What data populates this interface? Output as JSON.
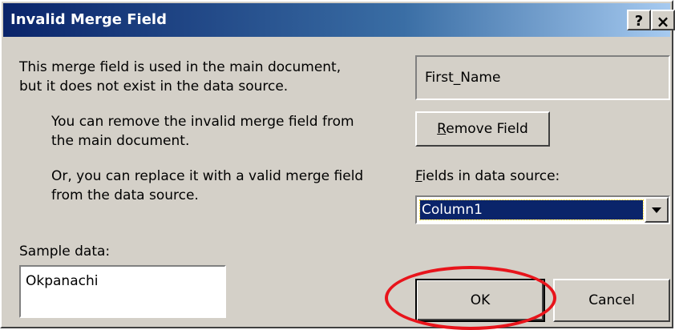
{
  "dialog": {
    "title": "Invalid Merge Field",
    "help_button": "?",
    "close_button": "×"
  },
  "messages": {
    "line1": "This merge field is used in the main document,",
    "line2": "but it does not exist in the data source.",
    "remove_line1": "You can remove the invalid merge field from",
    "remove_line2": "the main document.",
    "replace_line1": "Or, you can replace it with a valid merge field",
    "replace_line2": "from the data source."
  },
  "field": {
    "name": "First_Name"
  },
  "remove_button": {
    "accel": "R",
    "rest": "emove Field"
  },
  "fields_in_source": {
    "label_accel": "F",
    "label_rest": "ields in data source:",
    "selected": "Column1"
  },
  "sample": {
    "label": "Sample data:",
    "value": "Okpanachi"
  },
  "buttons": {
    "ok": "OK",
    "cancel": "Cancel"
  },
  "annotation": {
    "color": "#e8141b",
    "target": "OK"
  }
}
